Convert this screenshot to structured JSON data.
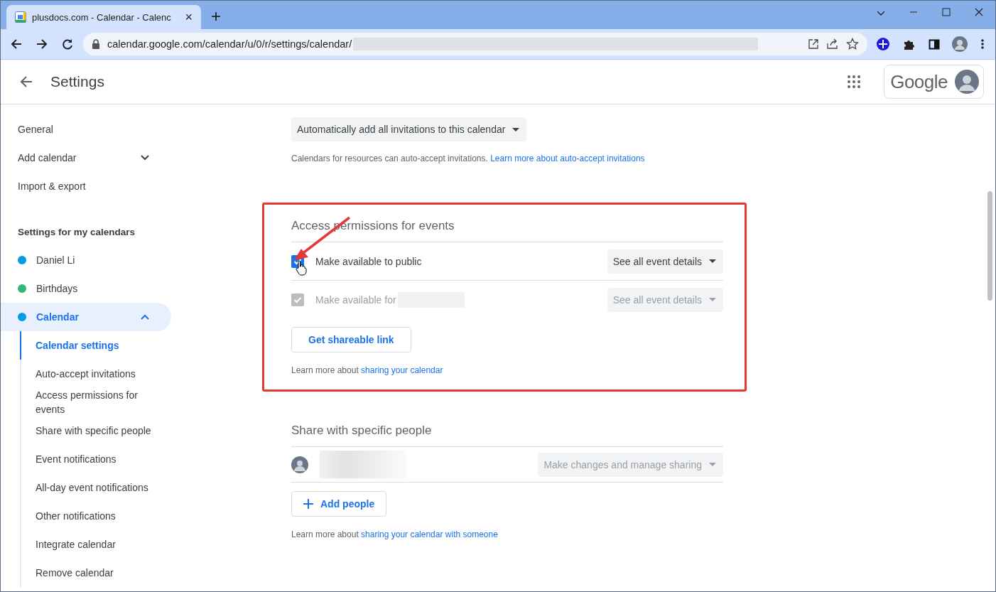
{
  "browser": {
    "tab_title": "plusdocs.com - Calendar - Calenc",
    "tab_close": "×",
    "new_tab": "+",
    "url": "calendar.google.com/calendar/u/0/r/settings/calendar/"
  },
  "header": {
    "title": "Settings",
    "account_label": "Google"
  },
  "sidebar": {
    "items": [
      {
        "label": "General"
      },
      {
        "label": "Add calendar",
        "expanded": false
      },
      {
        "label": "Import & export"
      }
    ],
    "section_title": "Settings for my calendars",
    "calendars": [
      {
        "name": "Daniel Li",
        "color": "#039be5",
        "selected": false,
        "expanded": false
      },
      {
        "name": "Birthdays",
        "color": "#33b679",
        "selected": false,
        "expanded": false
      },
      {
        "name": "Calendar",
        "color": "#039be5",
        "selected": true,
        "expanded": true,
        "children": [
          {
            "label": "Calendar settings",
            "selected": true
          },
          {
            "label": "Auto-accept invitations",
            "selected": false
          },
          {
            "label": "Access permissions for events",
            "selected": false
          },
          {
            "label": "Share with specific people",
            "selected": false
          },
          {
            "label": "Event notifications",
            "selected": false
          },
          {
            "label": "All-day event notifications",
            "selected": false
          },
          {
            "label": "Other notifications",
            "selected": false
          },
          {
            "label": "Integrate calendar",
            "selected": false
          },
          {
            "label": "Remove calendar",
            "selected": false
          }
        ]
      }
    ]
  },
  "auto_accept": {
    "dropdown": "Automatically add all invitations to this calendar",
    "note": "Calendars for resources can auto-accept invitations.",
    "link": "Learn more about auto-accept invitations"
  },
  "access_permissions": {
    "title": "Access permissions for events",
    "highlighted": true,
    "options": [
      {
        "label": "Make available to public",
        "checked": true,
        "disabled": false,
        "redacted": false,
        "dropdown": "See all event details"
      },
      {
        "label": "Make available for",
        "checked": true,
        "disabled": true,
        "redacted": true,
        "dropdown": "See all event details"
      }
    ],
    "button": "Get shareable link",
    "note": "Learn more about",
    "link": "sharing your calendar"
  },
  "share": {
    "title": "Share with specific people",
    "people": [
      {
        "permission": "Make changes and manage sharing",
        "disabled": true
      }
    ],
    "button": "Add people",
    "note": "Learn more about",
    "link": "sharing your calendar with someone"
  }
}
